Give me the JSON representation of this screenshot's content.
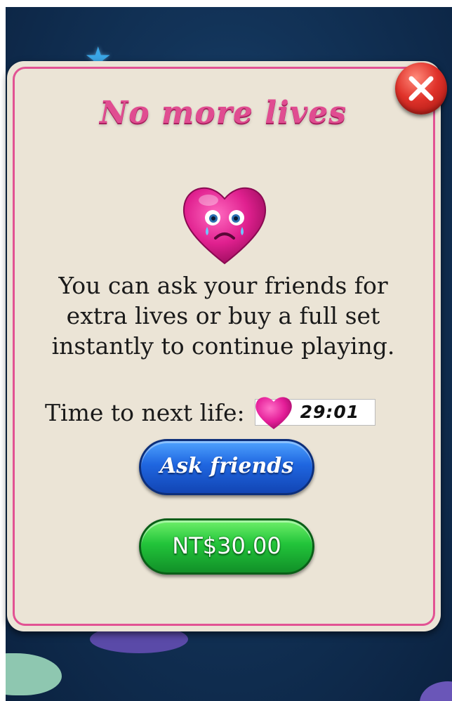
{
  "dialog": {
    "title": "No more lives",
    "message": "You can ask your friends for extra lives or buy a full set instantly to continue playing.",
    "timer_label": "Time to next life:",
    "timer_value": "29:01",
    "ask_button_label": "Ask friends",
    "buy_button_label": "NT$30.00"
  },
  "icons": {
    "close": "close-icon",
    "sad_heart": "sad-heart-icon",
    "life_heart": "life-heart-icon"
  },
  "colors": {
    "panel": "#ebe4d6",
    "border": "#e25293",
    "title": "#e04d91",
    "ask_button": "#1f66e0",
    "buy_button": "#22c43a",
    "close_button": "#e0322a"
  }
}
